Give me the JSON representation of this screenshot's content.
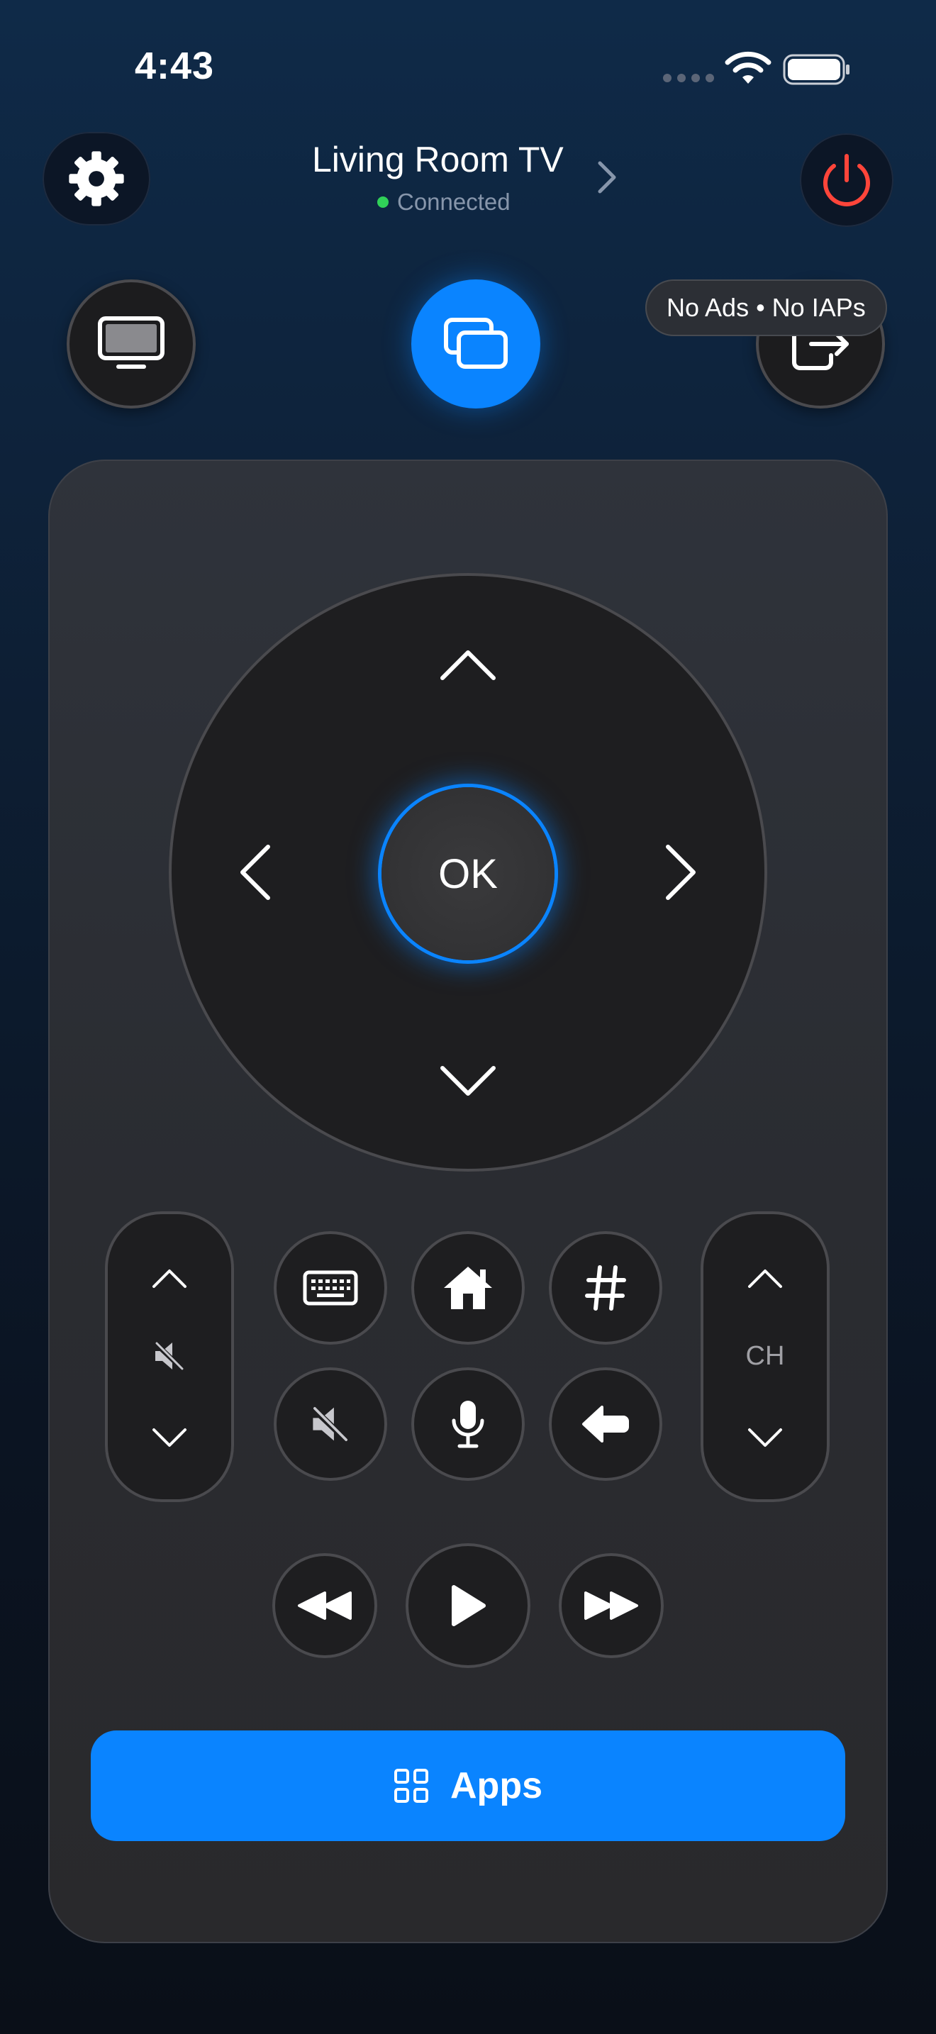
{
  "status_bar": {
    "time": "4:43"
  },
  "header": {
    "device_name": "Living Room TV",
    "connection_status": "Connected"
  },
  "badge": {
    "text": "No Ads • No IAPs"
  },
  "dpad": {
    "ok_label": "OK"
  },
  "channel": {
    "label": "CH"
  },
  "apps": {
    "label": "Apps"
  },
  "colors": {
    "accent": "#0a84ff",
    "power": "#ff453a",
    "connected": "#30d158",
    "button_bg": "#1e1e20",
    "panel_bg": "#2a2c31"
  },
  "icons": [
    "gear-icon",
    "power-icon",
    "tv-icon",
    "screen-mirror-icon",
    "input-source-icon",
    "keyboard-icon",
    "home-icon",
    "number-pad-icon",
    "mute-icon",
    "microphone-icon",
    "back-icon",
    "rewind-icon",
    "play-icon",
    "fast-forward-icon",
    "apps-grid-icon"
  ]
}
